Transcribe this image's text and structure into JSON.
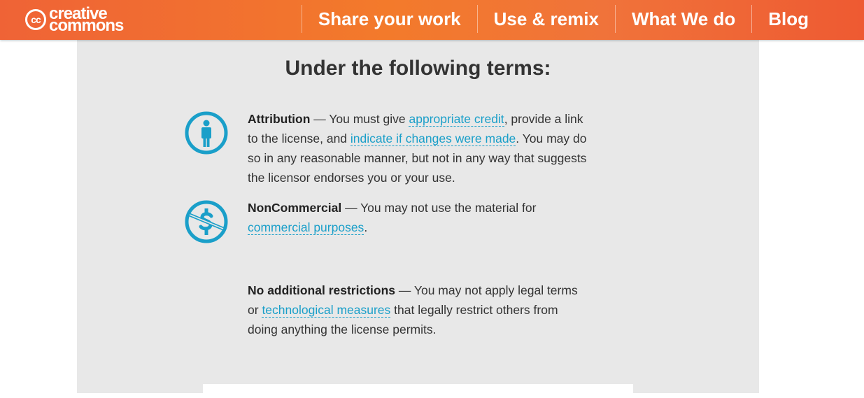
{
  "header": {
    "logo_cc": "cc",
    "logo_line1": "creative",
    "logo_line2": "commons",
    "nav": [
      "Share your work",
      "Use & remix",
      "What We do",
      "Blog"
    ]
  },
  "main": {
    "heading": "Under the following terms:",
    "terms": [
      {
        "icon": "attribution-icon",
        "title": "Attribution",
        "parts": [
          " — You must give ",
          "appropriate credit",
          ", provide a link to the license, and ",
          "indicate if changes were made",
          ". You may do so in any reasonable manner, but not in any way that suggests the licensor endorses you or your use."
        ]
      },
      {
        "icon": "noncommercial-icon",
        "title": "NonCommercial",
        "parts": [
          " — You may not use the material for ",
          "commercial purposes",
          "."
        ]
      },
      {
        "title": "No additional restrictions",
        "parts": [
          " — You may not apply legal terms or ",
          "technological measures",
          " that legally restrict others from doing anything the license permits."
        ]
      }
    ]
  },
  "colors": {
    "header_orange": "#f37a2b",
    "link_blue": "#1a9fc9",
    "icon_blue": "#1a9fc9",
    "panel_bg": "#e8e8e8"
  }
}
